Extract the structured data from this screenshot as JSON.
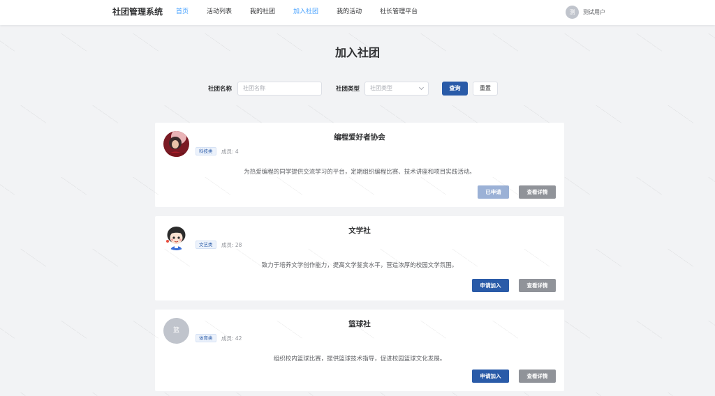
{
  "navbar": {
    "brand": "社团管理系统",
    "items": [
      {
        "label": "首页",
        "active": true
      },
      {
        "label": "活动列表",
        "active": false
      },
      {
        "label": "我的社团",
        "active": false
      },
      {
        "label": "加入社团",
        "active": false
      },
      {
        "label": "我的活动",
        "active": false
      },
      {
        "label": "社长管理平台",
        "active": false
      }
    ],
    "user": {
      "avatar_text": "测",
      "name": "测试用户"
    }
  },
  "page": {
    "title": "加入社团"
  },
  "search": {
    "name_label": "社团名称",
    "name_placeholder": "社团名称",
    "type_label": "社团类型",
    "type_placeholder": "社团类型",
    "query_button": "查询",
    "reset_button": "重置"
  },
  "clubs": [
    {
      "name": "编程爱好者协会",
      "tag": "科技类",
      "members": "成员: 4",
      "description": "为热爱编程的同学提供交流学习的平台，定期组织编程比赛、技术讲座和项目实践活动。",
      "action_label": "已申请",
      "detail_label": "查看详情"
    },
    {
      "name": "文学社",
      "tag": "文艺类",
      "members": "成员: 28",
      "description": "致力于培养文学创作能力，提高文学鉴赏水平，营造浓厚的校园文学氛围。",
      "action_label": "申请加入",
      "detail_label": "查看详情"
    },
    {
      "name": "篮球社",
      "avatar_text": "篮",
      "tag": "体育类",
      "members": "成员: 42",
      "description": "组织校内篮球比赛，提供篮球技术指导，促进校园篮球文化发展。",
      "action_label": "申请加入",
      "detail_label": "查看详情"
    }
  ],
  "colors": {
    "primary": "#2a5ba8",
    "nav_active": "#409eff",
    "applied": "#9bb1d6",
    "detail": "#909399",
    "background": "#f2f3f5"
  }
}
